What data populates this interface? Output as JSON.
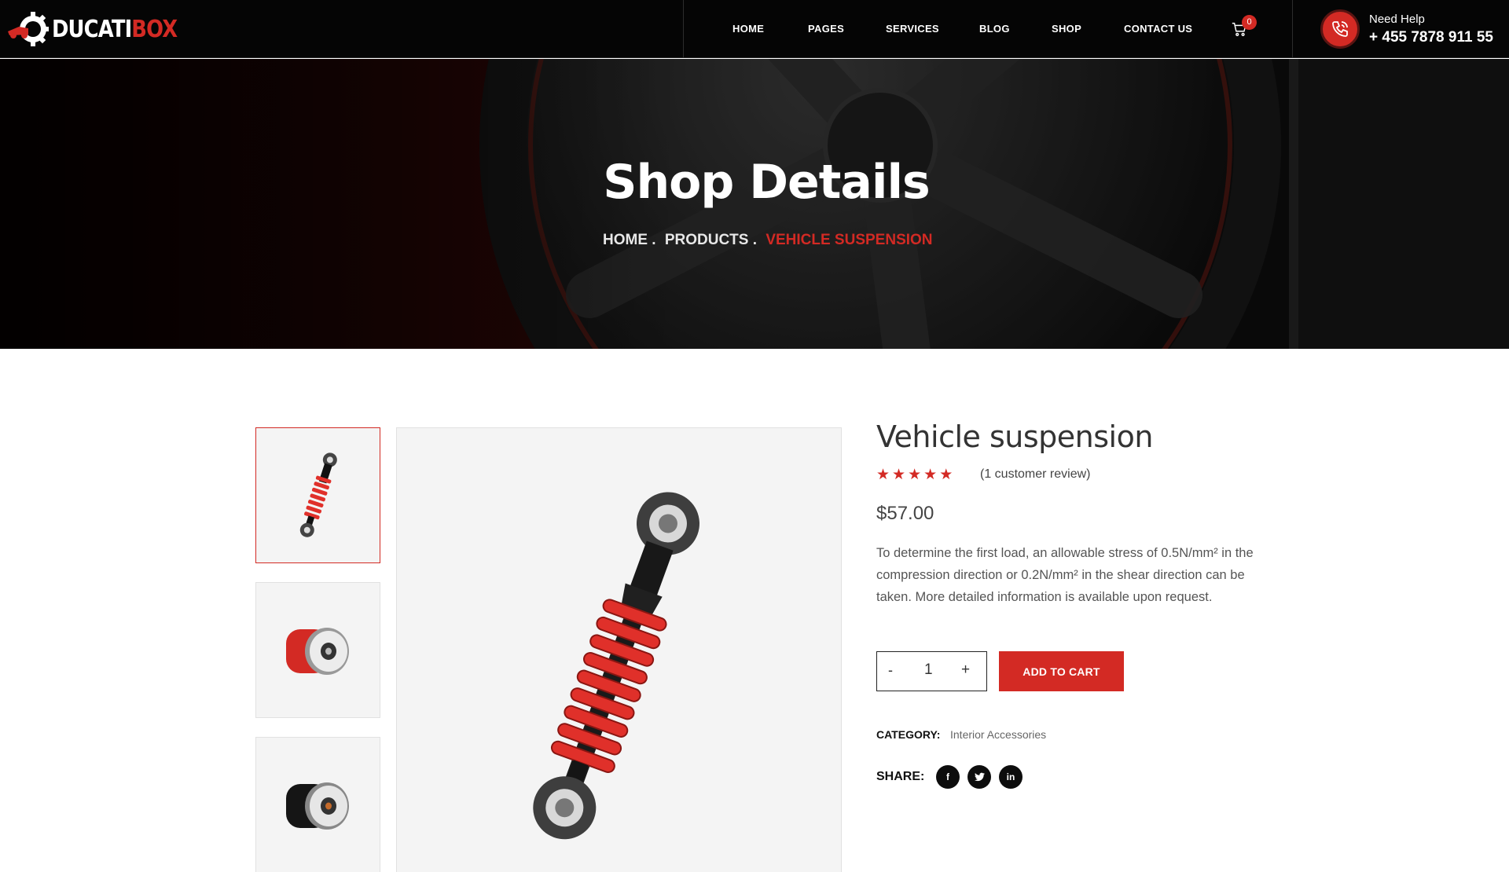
{
  "brand": {
    "name_white": "DUCATI",
    "name_red": "BOX"
  },
  "nav": {
    "items": [
      "HOME",
      "PAGES",
      "SERVICES",
      "BLOG",
      "SHOP",
      "CONTACT US"
    ],
    "cart_count": "0",
    "cart_icon": "cart-icon"
  },
  "help": {
    "label": "Need Help",
    "phone": "+ 455 7878 911 55",
    "icon": "phone-icon"
  },
  "hero": {
    "title": "Shop Details",
    "breadcrumb": [
      "HOME .",
      "PRODUCTS .",
      "VEHICLE SUSPENSION"
    ]
  },
  "product": {
    "title": "Vehicle suspension",
    "rating": 5,
    "review_text": "(1 customer review)",
    "price": "$57.00",
    "description": "To determine the first load, an allowable stress of 0.5N/mm² in the compression direction or 0.2N/mm² in the shear direction can be taken. More detailed information is available upon request.",
    "quantity": "1",
    "qty_minus": "-",
    "qty_plus": "+",
    "add_to_cart": "ADD TO CART",
    "category_label": "CATEGORY:",
    "category": "Interior Accessories",
    "share_label": "SHARE:",
    "share_icons": [
      "facebook-icon",
      "twitter-icon",
      "linkedin-icon"
    ]
  },
  "colors": {
    "accent": "#d32a24",
    "dark": "#050505",
    "panel": "#f4f4f4"
  }
}
